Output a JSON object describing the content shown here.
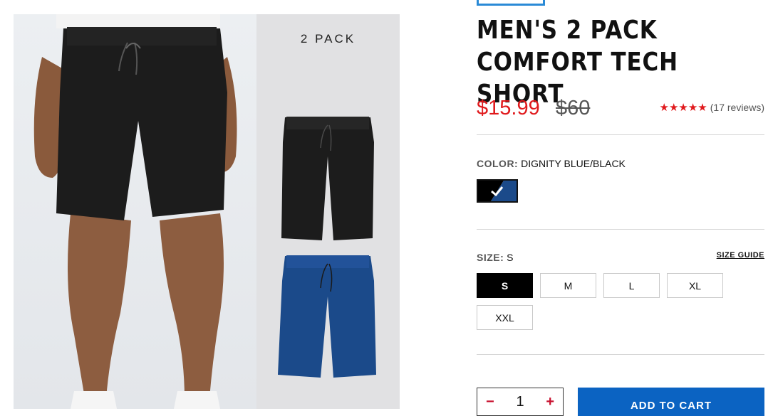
{
  "product": {
    "title_line1": "MEN'S 2 PACK",
    "title_line2": "COMFORT TECH SHORT",
    "sale_price": "$15.99",
    "original_price": "$60",
    "stars": "★★★★★",
    "rating_value": 5,
    "reviews_text": "(17 reviews)"
  },
  "gallery": {
    "pack_label": "2 PACK"
  },
  "color": {
    "label": "COLOR:",
    "value": "DIGNITY BLUE/BLACK",
    "swatch_colors": [
      "#000000",
      "#1b4a8a"
    ]
  },
  "size": {
    "label": "SIZE:",
    "value": "S",
    "guide_label": "SIZE GUIDE",
    "options": [
      "S",
      "M",
      "L",
      "XL",
      "XXL"
    ],
    "selected": "S"
  },
  "cart": {
    "quantity": "1",
    "minus": "−",
    "plus": "+",
    "add_label": "ADD TO CART"
  },
  "colors": {
    "sale": "#e0191c",
    "button": "#0b63c2",
    "shorts_black": "#1c1c1c",
    "shorts_blue": "#1b4a8a"
  }
}
